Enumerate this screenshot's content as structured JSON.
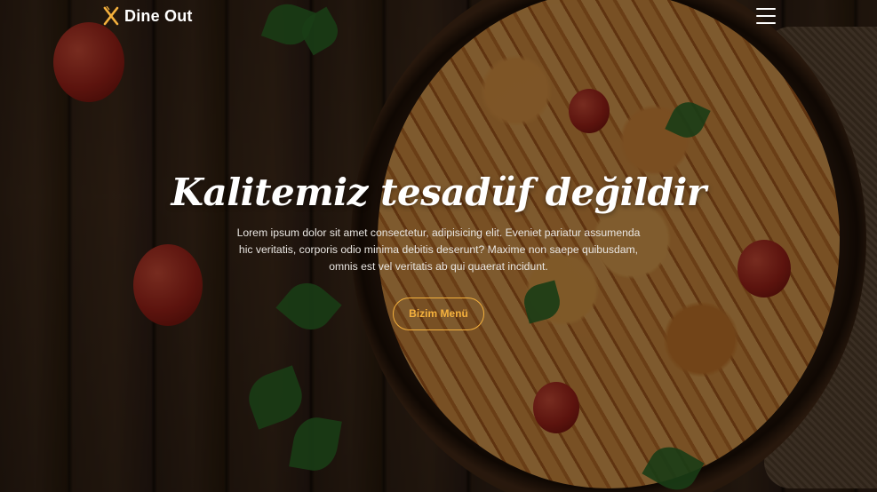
{
  "nav": {
    "brand": "Dine Out",
    "logo_icon": "fork-knife-icon",
    "menu_icon": "hamburger-menu-icon"
  },
  "hero": {
    "headline": "Kalitemiz tesadüf değildir",
    "description": "Lorem ipsum dolor sit amet consectetur, adipisicing elit. Eveniet pariatur assumenda hic veritatis, corporis odio minima debitis deserunt? Maxime non saepe quibusdam, omnis est vel veritatis ab qui quaerat incidunt.",
    "cta_label": "Bizim Menü"
  },
  "colors": {
    "accent": "#f5b13d",
    "text": "#ffffff"
  }
}
